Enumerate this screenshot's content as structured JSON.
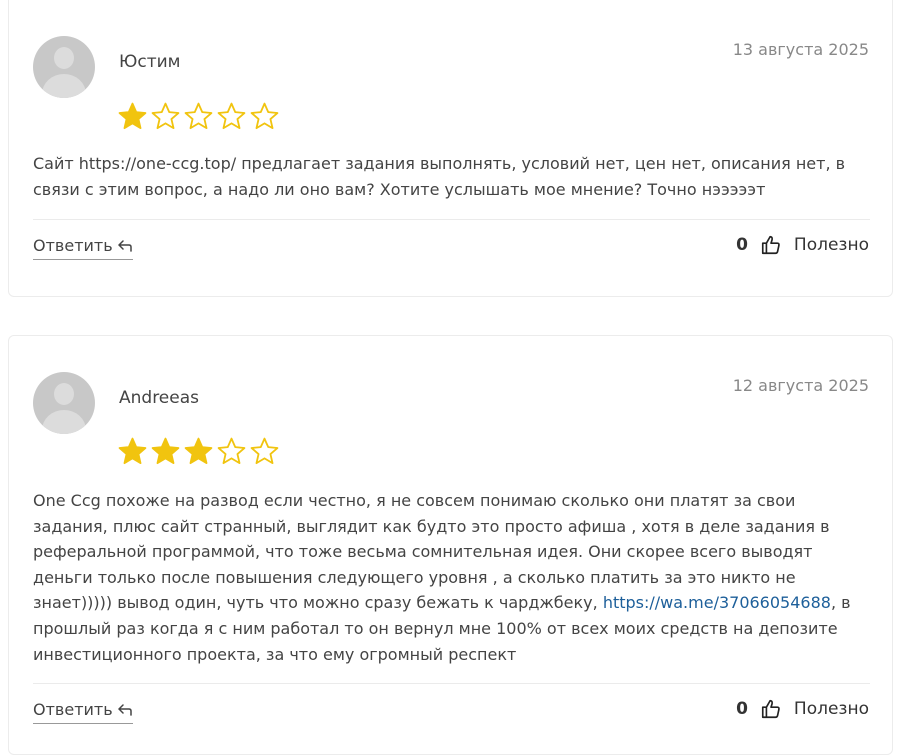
{
  "colors": {
    "star_filled": "#f1c40f",
    "star_outline": "#f1c40f",
    "link": "#1d5f9a",
    "text": "#444444",
    "date": "#888888"
  },
  "reviews": [
    {
      "author": "Юстим",
      "date": "13 августа 2025",
      "rating": 1,
      "max_rating": 5,
      "text": "Сайт https://one-ccg.top/ предлагает задания выполнять, условий нет, цен нет, описания нет, в связи с этим вопрос, а надо ли оно вам? Хотите услышать мое мнение? Точно нэээээт",
      "reply_label": "Ответить",
      "helpful_count": "0",
      "helpful_label": "Полезно"
    },
    {
      "author": "Andreeas",
      "date": "12 августа 2025",
      "rating": 3,
      "max_rating": 5,
      "text_before_link": "One Ccg похоже на развод если честно, я не совсем понимаю сколько они платят за свои задания, плюс сайт странный, выглядит как будто это просто афиша , хотя в деле задания в реферальной программой, что тоже весьма сомнительная идея. Они скорее всего выводят деньги только после повышения следующего уровня , а сколько платить за это никто не знает))))) вывод один, чуть что можно сразу бежать к чарджбеку, ",
      "link_text": "https://wa.me/37066054688",
      "text_after_link": ", в прошлый раз когда я с ним работал то он вернул мне 100% от всех моих средств на депозите инвестиционного проекта, за что ему огромный респект",
      "reply_label": "Ответить",
      "helpful_count": "0",
      "helpful_label": "Полезно"
    }
  ]
}
